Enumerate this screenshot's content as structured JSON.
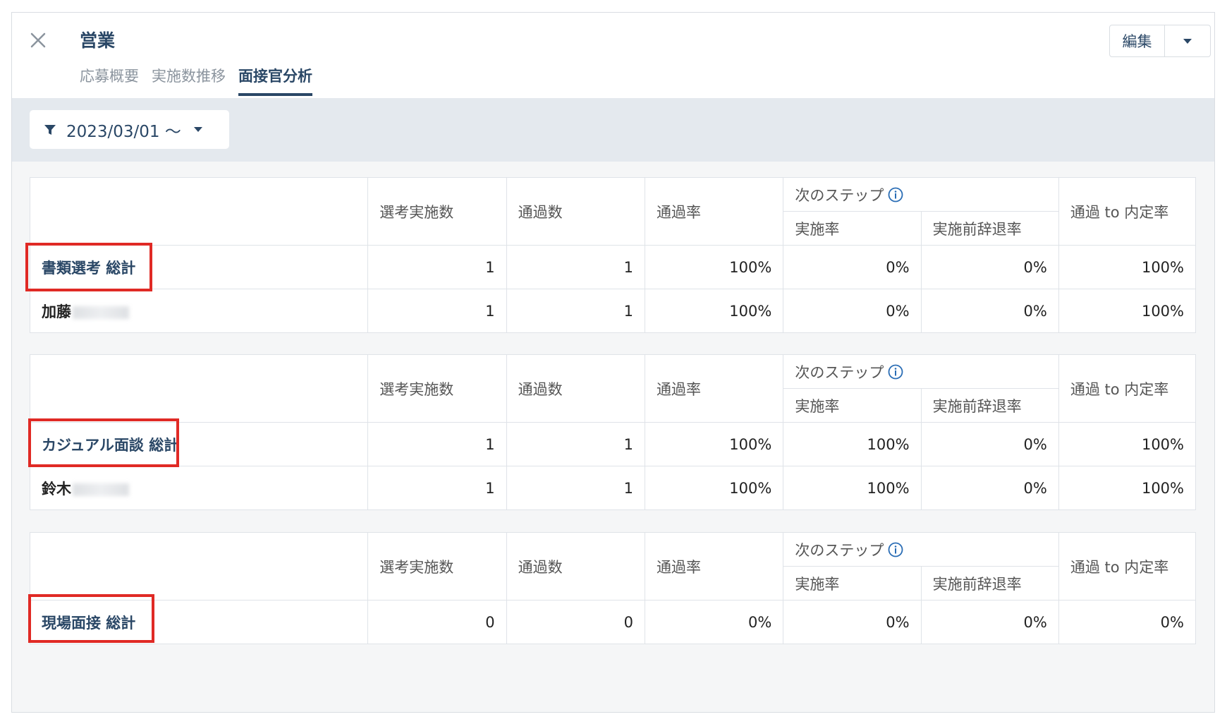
{
  "header": {
    "title": "営業",
    "tabs": [
      "応募概要",
      "実施数推移",
      "面接官分析"
    ],
    "edit_label": "編集"
  },
  "filter": {
    "label": "2023/03/01 〜"
  },
  "columns": {
    "conducted": "選考実施数",
    "passed": "通過数",
    "pass_rate": "通過率",
    "next_step": "次のステップ",
    "exec_rate": "実施率",
    "decline_rate": "実施前辞退率",
    "offer_rate": "通過 to 内定率"
  },
  "blocks": [
    {
      "total": {
        "name": "書類選考 総計",
        "values": [
          "1",
          "1",
          "100%",
          "0%",
          "0%",
          "100%"
        ]
      },
      "person": {
        "name": "加藤",
        "values": [
          "1",
          "1",
          "100%",
          "0%",
          "0%",
          "100%"
        ]
      }
    },
    {
      "total": {
        "name": "カジュアル面談 総計",
        "values": [
          "1",
          "1",
          "100%",
          "100%",
          "0%",
          "100%"
        ]
      },
      "person": {
        "name": "鈴木",
        "values": [
          "1",
          "1",
          "100%",
          "100%",
          "0%",
          "100%"
        ]
      }
    },
    {
      "total": {
        "name": "現場面接 総計",
        "values": [
          "0",
          "0",
          "0%",
          "0%",
          "0%",
          "0%"
        ]
      }
    }
  ],
  "colors": {
    "accent": "#2a4766",
    "highlight": "#e02a25",
    "filter_bg": "#e4e9ee"
  }
}
